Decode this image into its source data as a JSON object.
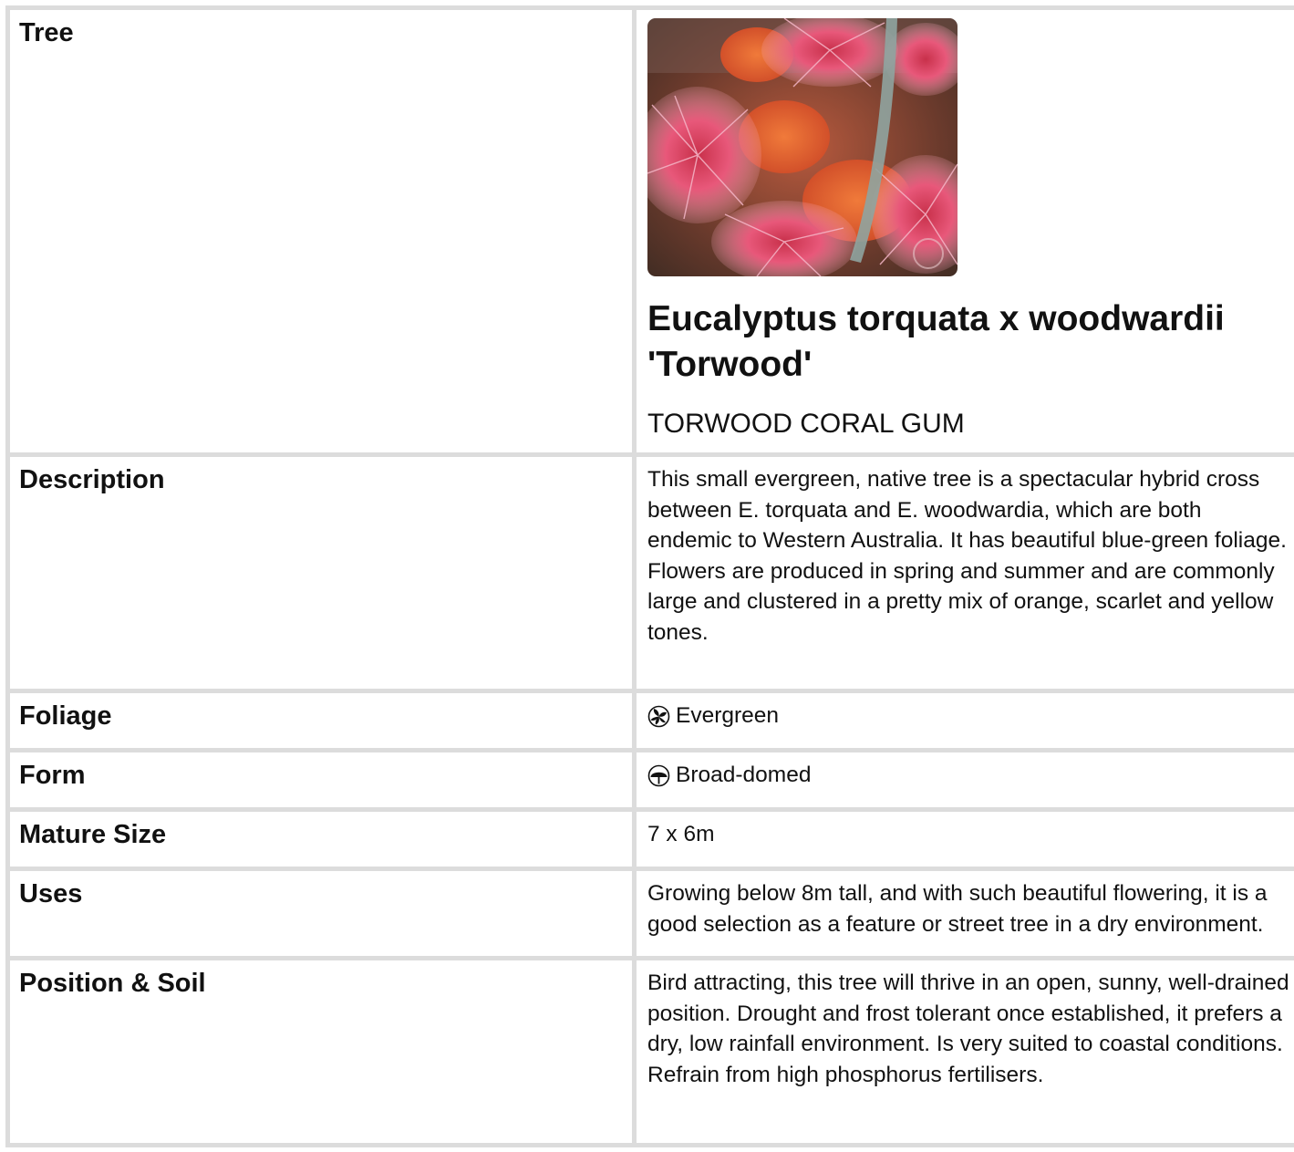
{
  "tree": {
    "label": "Tree",
    "species": "Eucalyptus torquata x woodwardii 'Torwood'",
    "common_name": "TORWOOD CORAL GUM",
    "photo_icon": "flower-photo"
  },
  "rows": {
    "description": {
      "label": "Description",
      "value": "This small evergreen, native tree is a spectacular hybrid cross between E. torquata and E. woodwardia, which are both endemic to Western Australia. It has beautiful blue-green foliage. Flowers are produced in spring and summer and are commonly large and clustered in a pretty mix of orange, scarlet and yellow tones."
    },
    "foliage": {
      "label": "Foliage",
      "value": "Evergreen",
      "icon": "leaf-icon"
    },
    "form": {
      "label": "Form",
      "value": "Broad-domed",
      "icon": "tree-icon"
    },
    "mature_size": {
      "label": "Mature Size",
      "value": "7 x 6m"
    },
    "uses": {
      "label": "Uses",
      "value": "Growing below 8m tall, and with such beautiful flowering, it is a good selection as a feature or street tree in a dry environment."
    },
    "position_soil": {
      "label": "Position & Soil",
      "value": "Bird attracting, this tree will thrive in an open, sunny, well-drained position. Drought and frost tolerant once established, it prefers a dry, low rainfall environment. Is very suited to coastal conditions. Refrain from high phosphorus fertilisers."
    }
  },
  "colors": {
    "border": "#dcdcdc",
    "text": "#111111"
  }
}
